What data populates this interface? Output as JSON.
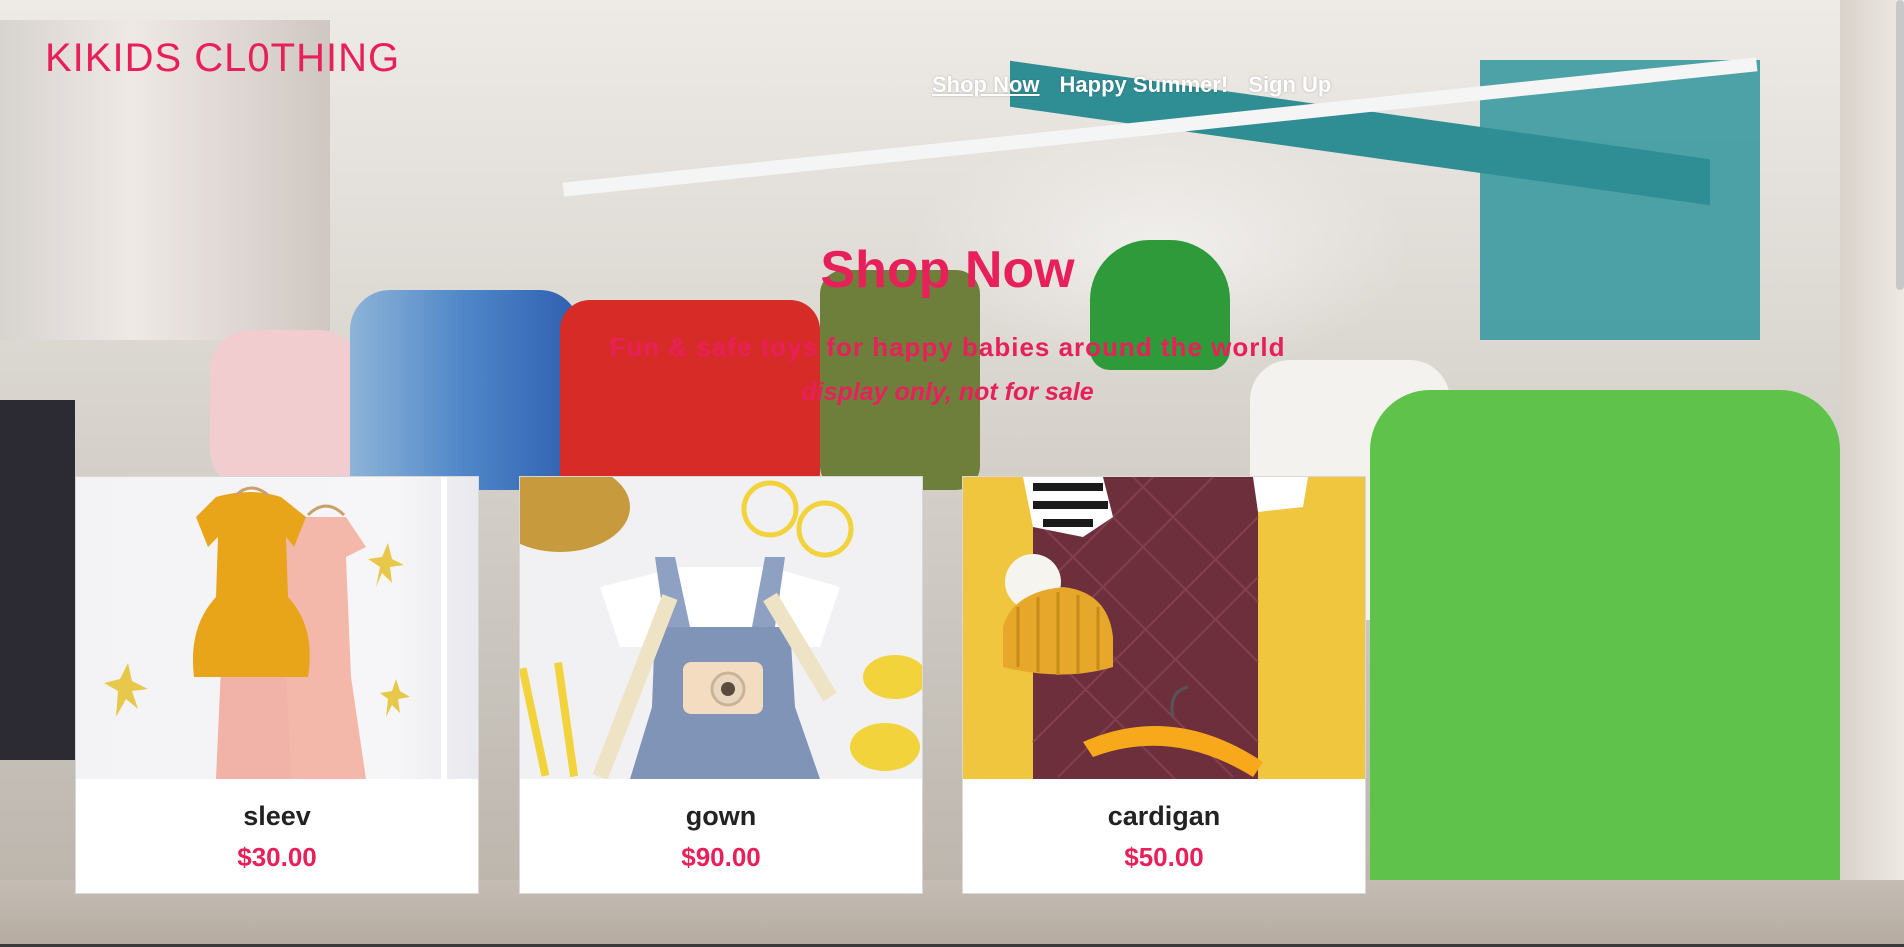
{
  "brand": {
    "name": "KIKIDS CL0THING"
  },
  "nav": {
    "items": [
      {
        "label": "Shop Now",
        "active": true
      },
      {
        "label": "Happy Summer!",
        "active": false
      },
      {
        "label": "Sign Up",
        "active": false
      }
    ]
  },
  "hero": {
    "title": "Shop Now",
    "subtitle": "Fun & safe toys for happy babies around the world",
    "note": "display only, not for sale"
  },
  "products": [
    {
      "name": "sleev",
      "price": "$30.00"
    },
    {
      "name": "gown",
      "price": "$90.00"
    },
    {
      "name": "cardigan",
      "price": "$50.00"
    }
  ],
  "colors": {
    "accent": "#e8205a",
    "nav_text": "#ffffff",
    "card_bg": "#ffffff"
  }
}
